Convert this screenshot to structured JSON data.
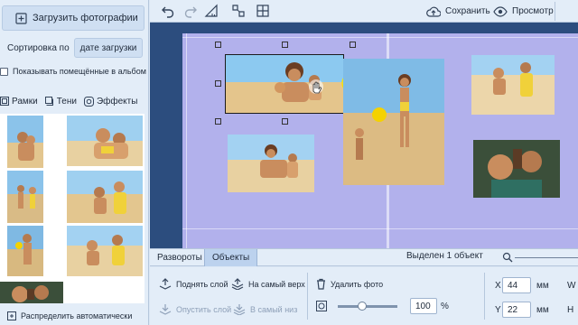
{
  "left_panel": {
    "upload_label": "Загрузить фотографии",
    "sort_label": "Сортировка по",
    "sort_value": "дате загрузки",
    "show_placed_label": "Показывать помещённые в альбом",
    "effects": [
      {
        "label": "Рамки",
        "icon": "frame-icon"
      },
      {
        "label": "Тени",
        "icon": "shadow-icon"
      },
      {
        "label": "Эффекты",
        "icon": "effects-icon"
      }
    ],
    "auto_label": "Распределить автоматически"
  },
  "toolbar": {
    "save_label": "Сохранить",
    "preview_label": "Просмотр",
    "tools": [
      "undo-icon",
      "redo-icon",
      "ruler-icon",
      "grid-snap-icon",
      "grid-icon"
    ]
  },
  "bottom": {
    "tabs": [
      "Развороты",
      "Объекты"
    ],
    "active_tab": "Объекты",
    "selected_text": "Выделен 1 объект"
  },
  "props": {
    "bring_up": "Поднять слой",
    "to_front": "На самый верх",
    "lower": "Опустить слой",
    "to_back": "В самый низ",
    "delete": "Удалить фото",
    "opacity_value": "100",
    "opacity_unit": "%",
    "x_label": "X",
    "x_value": "44",
    "y_label": "Y",
    "y_value": "22",
    "unit": "мм",
    "w_label": "W",
    "h_label": "H"
  },
  "colors": {
    "accent": "#2c4d7e",
    "sheet": "#b2b1ec",
    "panel": "#e3edf8"
  }
}
